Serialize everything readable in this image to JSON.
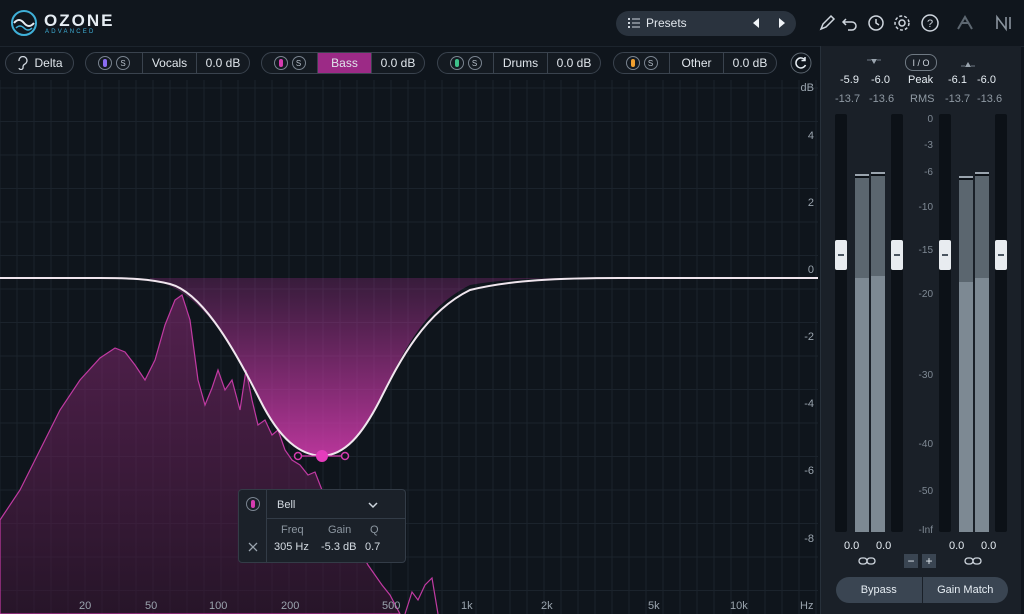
{
  "app": {
    "name": "OZONE",
    "edition": "ADVANCED"
  },
  "presets": {
    "label": "Presets"
  },
  "bands": [
    {
      "label": "Delta"
    },
    {
      "label": "Vocals",
      "gain": "0.0 dB",
      "color": "#8b6df2",
      "solo": "S"
    },
    {
      "label": "Bass",
      "gain": "0.0 dB",
      "color": "#d63cb0",
      "solo": "S",
      "active": true
    },
    {
      "label": "Drums",
      "gain": "0.0 dB",
      "color": "#3ec08a",
      "solo": "S"
    },
    {
      "label": "Other",
      "gain": "0.0 dB",
      "color": "#f0a030",
      "solo": "S"
    }
  ],
  "eq": {
    "unit": "dB",
    "y_ticks": [
      "4",
      "2",
      "0",
      "-2",
      "-4",
      "-6",
      "-8"
    ],
    "x_ticks": [
      "20",
      "50",
      "100",
      "200",
      "500",
      "1k",
      "2k",
      "5k",
      "10k"
    ],
    "x_unit": "Hz",
    "accent": "#d63cb0"
  },
  "band_panel": {
    "filter_type": "Bell",
    "headers": {
      "freq": "Freq",
      "gain": "Gain",
      "q": "Q"
    },
    "values": {
      "freq": "305 Hz",
      "gain": "-5.3 dB",
      "q": "0.7"
    }
  },
  "meter": {
    "io_label": "I / O",
    "input_peak": [
      "-5.9",
      "-6.0"
    ],
    "input_rms": [
      "-13.7",
      "-13.6"
    ],
    "output_peak": [
      "-6.1",
      "-6.0"
    ],
    "output_rms": [
      "-13.7",
      "-13.6"
    ],
    "peak_label": "Peak",
    "rms_label": "RMS",
    "scale": [
      "0",
      "-3",
      "-6",
      "-10",
      "-15",
      "-20",
      "-30",
      "-40",
      "-50",
      "-Inf"
    ],
    "input_trim": [
      "0.0",
      "0.0"
    ],
    "output_trim": [
      "0.0",
      "0.0"
    ],
    "bypass_label": "Bypass",
    "gain_match_label": "Gain Match"
  }
}
